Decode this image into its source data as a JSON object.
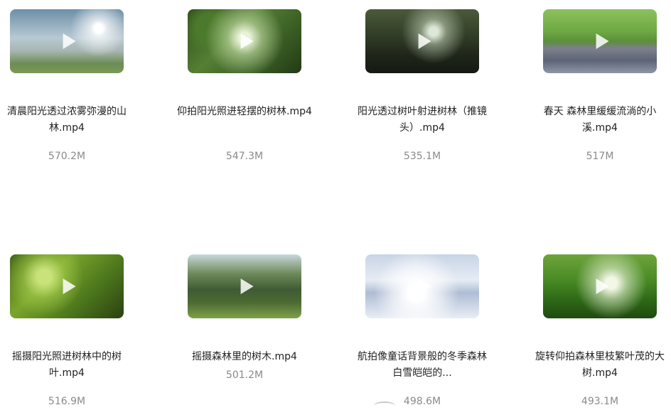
{
  "videos": [
    {
      "title": "清晨阳光透过浓雾弥漫的山林.mp4",
      "size": "570.2M",
      "play_icon": "play-icon"
    },
    {
      "title": "仰拍阳光照进轻摆的树林.mp4",
      "size": "547.3M",
      "play_icon": "play-icon"
    },
    {
      "title": "阳光透过树叶射进树林（推镜头）.mp4",
      "size": "535.1M",
      "play_icon": "play-icon"
    },
    {
      "title": "春天 森林里缓缓流淌的小溪.mp4",
      "size": "517M",
      "play_icon": "play-icon"
    },
    {
      "title": "摇摄阳光照进树林中的树叶.mp4",
      "size": "516.9M",
      "play_icon": "play-icon"
    },
    {
      "title": "摇摄森林里的树木.mp4",
      "size": "501.2M",
      "play_icon": "play-icon"
    },
    {
      "title": "航拍像童话背景般的冬季森林白雪皑皑的...",
      "size": "498.6M",
      "play_icon": "play-icon"
    },
    {
      "title": "旋转仰拍森林里枝繁叶茂的大树.mp4",
      "size": "493.1M",
      "play_icon": "play-icon"
    }
  ]
}
